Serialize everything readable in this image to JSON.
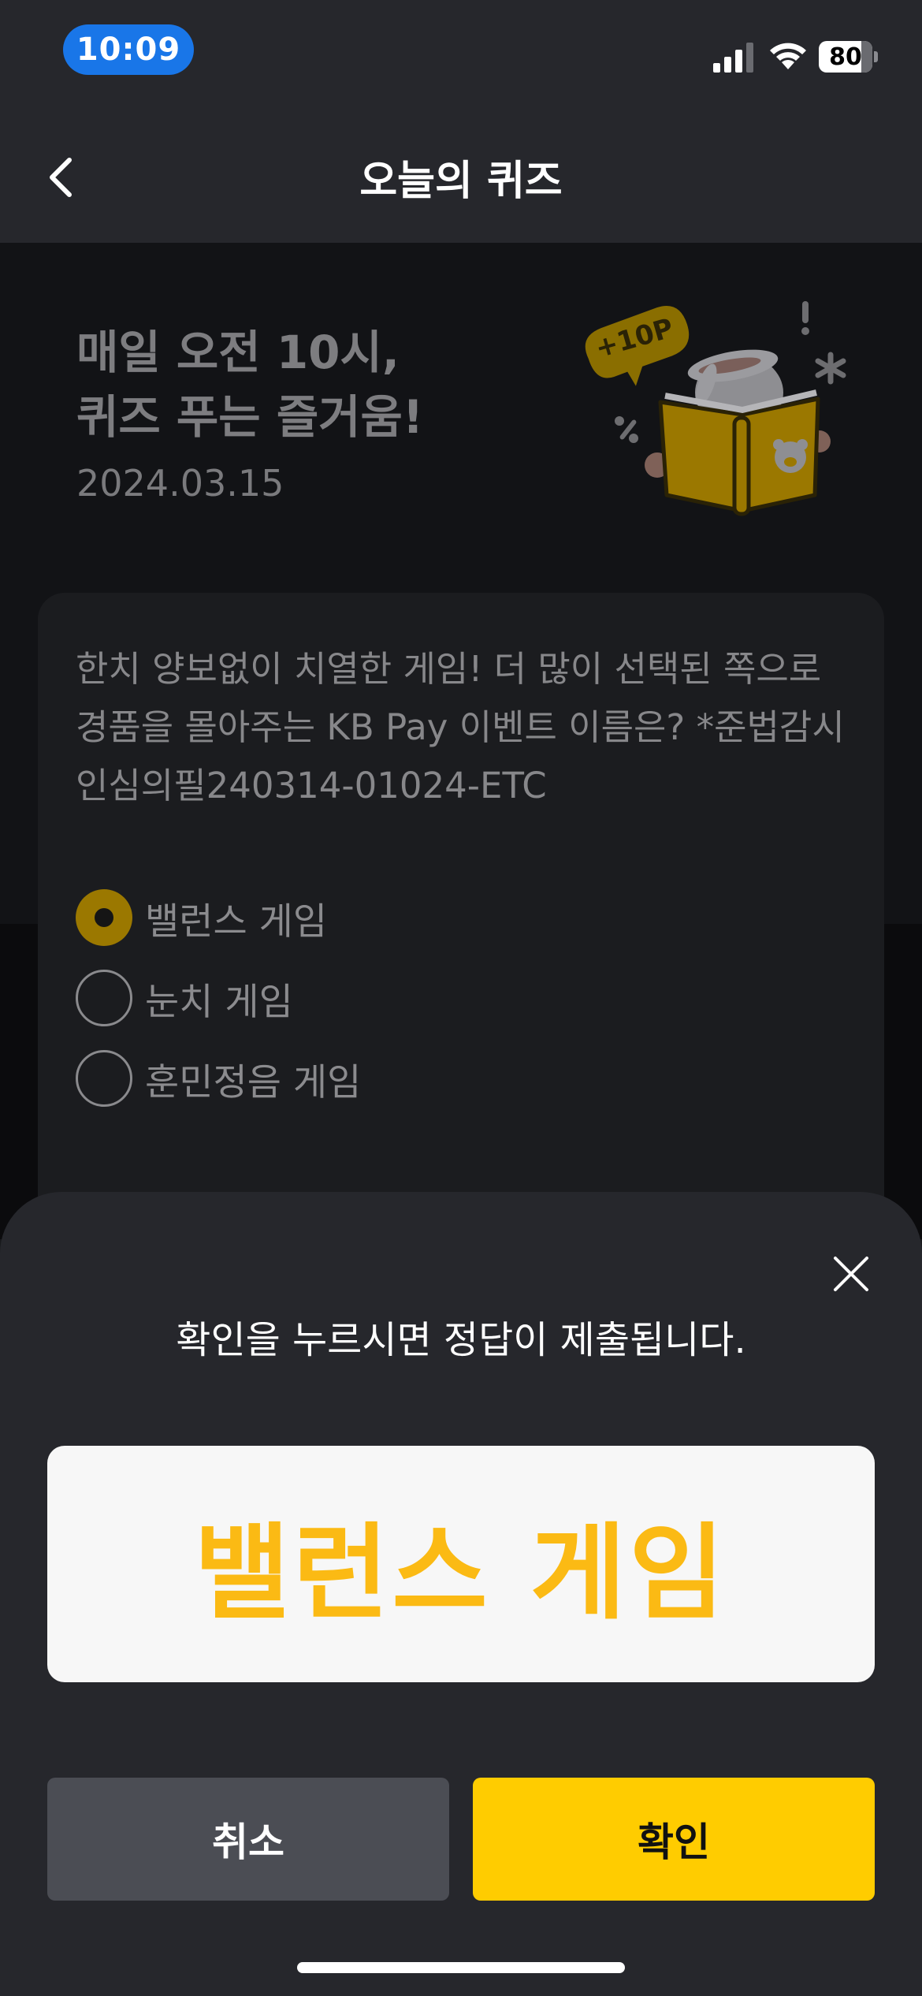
{
  "status_bar": {
    "time": "10:09",
    "battery_percent": 80,
    "battery_level": 0.8,
    "icons": [
      "cellular-signal-icon",
      "wifi-icon",
      "battery-icon"
    ]
  },
  "nav": {
    "title": "오늘의 퀴즈",
    "back_icon": "chevron-left-icon"
  },
  "hero": {
    "headline_line1": "매일 오전 10시,",
    "headline_line2": "퀴즈 푸는 즐거움!",
    "date": "2024.03.15",
    "illustration": {
      "points_badge": "+10P",
      "description_icon": "rabbit-reading-book-illustration"
    }
  },
  "quiz": {
    "question": "한치 양보없이 치열한 게임! 더 많이 선택된 쪽으로 경품을 몰아주는 KB Pay 이벤트 이름은? *준법감시인심의필240314-01024-ETC",
    "options": [
      {
        "label": "밸런스 게임",
        "selected": true
      },
      {
        "label": "눈치 게임",
        "selected": false
      },
      {
        "label": "훈민정음 게임",
        "selected": false
      }
    ]
  },
  "sheet": {
    "message": "확인을 누르시면 정답이 제출됩니다.",
    "answer": "밸런스 게임",
    "cancel_label": "취소",
    "confirm_label": "확인",
    "close_icon": "close-icon"
  },
  "colors": {
    "accent_yellow": "#ffcc00",
    "answer_text": "#fbba14",
    "sheet_bg": "#26272c",
    "cancel_bg": "#4b4d54",
    "time_pill": "#1976e8"
  }
}
